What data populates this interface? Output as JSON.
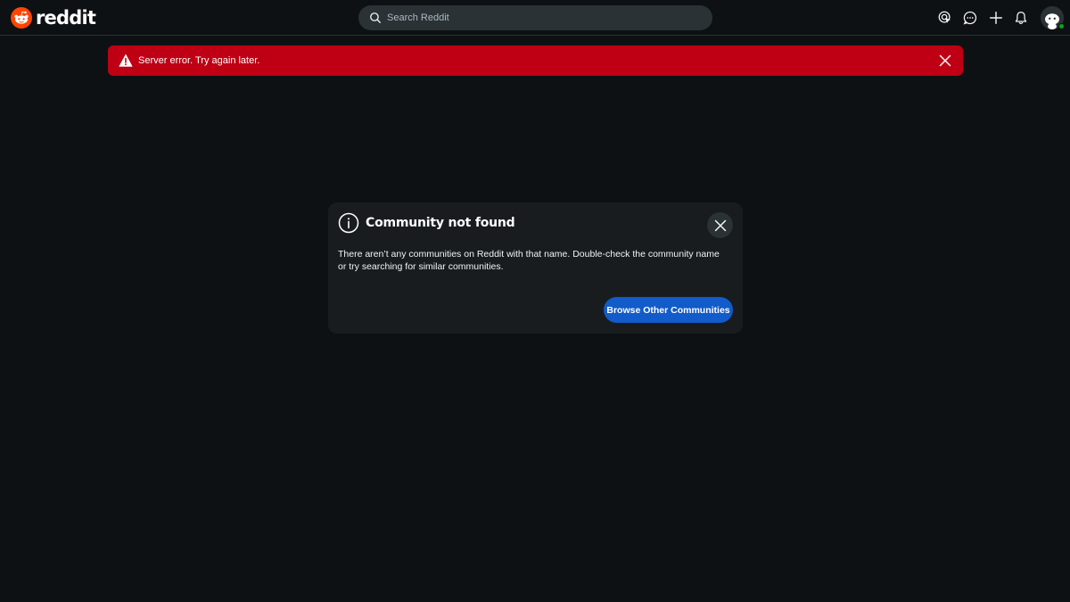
{
  "header": {
    "logo_text": "reddit",
    "search": {
      "placeholder": "Search Reddit"
    },
    "icons": [
      "advertise-icon",
      "chat-icon",
      "create-plus-icon",
      "notification-bell-icon",
      "user-avatar"
    ]
  },
  "error_banner": {
    "message": "Server error. Try again later.",
    "color": "#bf0014"
  },
  "modal": {
    "title": "Community not found",
    "body": "There aren’t any communities on Reddit with that name. Double-check the community name or try searching for similar communities.",
    "button_label": "Browse Other Communities"
  },
  "colors": {
    "background": "#0e1113",
    "brand": "#ff4500",
    "primary_button": "#115bca",
    "online_status": "#01a816"
  }
}
